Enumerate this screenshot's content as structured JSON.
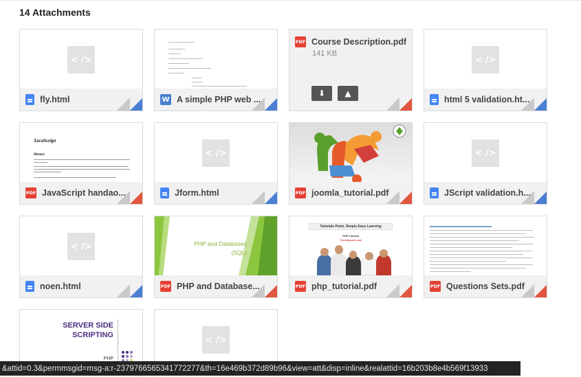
{
  "header": {
    "title": "14 Attachments"
  },
  "attachments": [
    {
      "name": "fly.html",
      "type": "html"
    },
    {
      "name": "A simple PHP web ...",
      "type": "word"
    },
    {
      "name": "Course Description.pdf",
      "type": "pdf",
      "size": "141 KB"
    },
    {
      "name": "html 5 validation.ht...",
      "type": "html"
    },
    {
      "name": "JavaScript handao...",
      "type": "pdf",
      "preview_title": "JavaScript",
      "preview_heading": "History"
    },
    {
      "name": "Jform.html",
      "type": "html"
    },
    {
      "name": "joomla_tutorial.pdf",
      "type": "pdf"
    },
    {
      "name": "JScript validation.h...",
      "type": "html"
    },
    {
      "name": "noen.html",
      "type": "html"
    },
    {
      "name": "PHP and Database...",
      "type": "pdf",
      "preview_lines": [
        "PHP and Databases",
        "(SQL)"
      ]
    },
    {
      "name": "php_tutorial.pdf",
      "type": "pdf",
      "preview_banner": "Tutorials Point, Simply Easy Learning",
      "preview_sub": "PHP Tutorial",
      "preview_link": "Tutorialspoint.com"
    },
    {
      "name": "Questions Sets.pdf",
      "type": "pdf"
    },
    {
      "name": "",
      "type": "pdf",
      "preview_lines": [
        "SERVER SIDE",
        "SCRIPTING"
      ],
      "preview_small": "PHP"
    },
    {
      "name": "",
      "type": "html"
    }
  ],
  "icons": {
    "code_placeholder": "< />",
    "pdf_label": "PDF",
    "word_label": "W",
    "download": "⬇",
    "drive": "▲"
  },
  "status_bar": {
    "url": "&attid=0.3&permmsgid=msg-a:r-2379766565341772277&th=16e469b372d89b96&view=att&disp=inline&realattid=16b203b8e4b569f13933"
  },
  "colors": {
    "pdf_red": "#e44134",
    "html_blue": "#4285f4",
    "corner_grey": "#c9c9c9"
  }
}
